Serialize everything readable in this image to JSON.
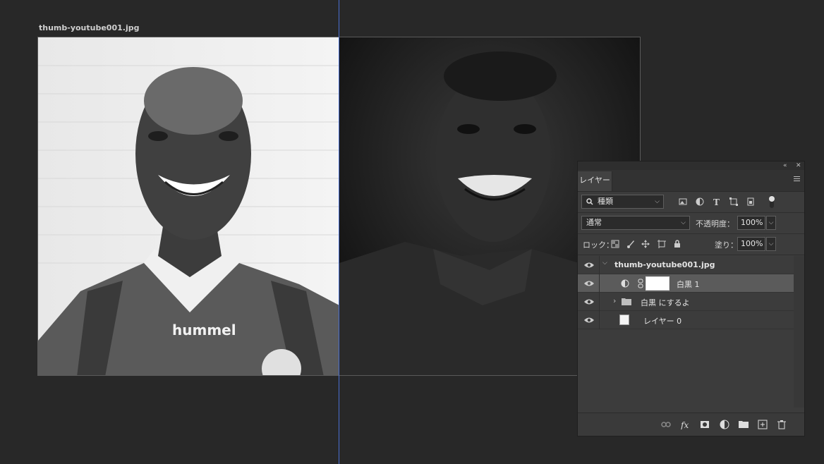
{
  "document": {
    "title": "thumb-youtube001.jpg"
  },
  "canvas": {
    "left_image_text": "hummel"
  },
  "layers_panel": {
    "tab_label": "レイヤー",
    "filter": {
      "value": "種類"
    },
    "blend_mode": {
      "value": "通常"
    },
    "opacity": {
      "label": "不透明度：",
      "value": "100%"
    },
    "lock": {
      "label": "ロック："
    },
    "fill": {
      "label": "塗り：",
      "value": "100%"
    },
    "layers": [
      {
        "name": "thumb-youtube001.jpg",
        "type": "group-open"
      },
      {
        "name": "白黒 1",
        "type": "adjustment",
        "selected": true
      },
      {
        "name": "白黒 にするよ",
        "type": "group-closed"
      },
      {
        "name": "レイヤー 0",
        "type": "pixel"
      }
    ],
    "colors": {
      "selected_row": "#5b5b5b",
      "guide": "#4a6fd0"
    }
  }
}
